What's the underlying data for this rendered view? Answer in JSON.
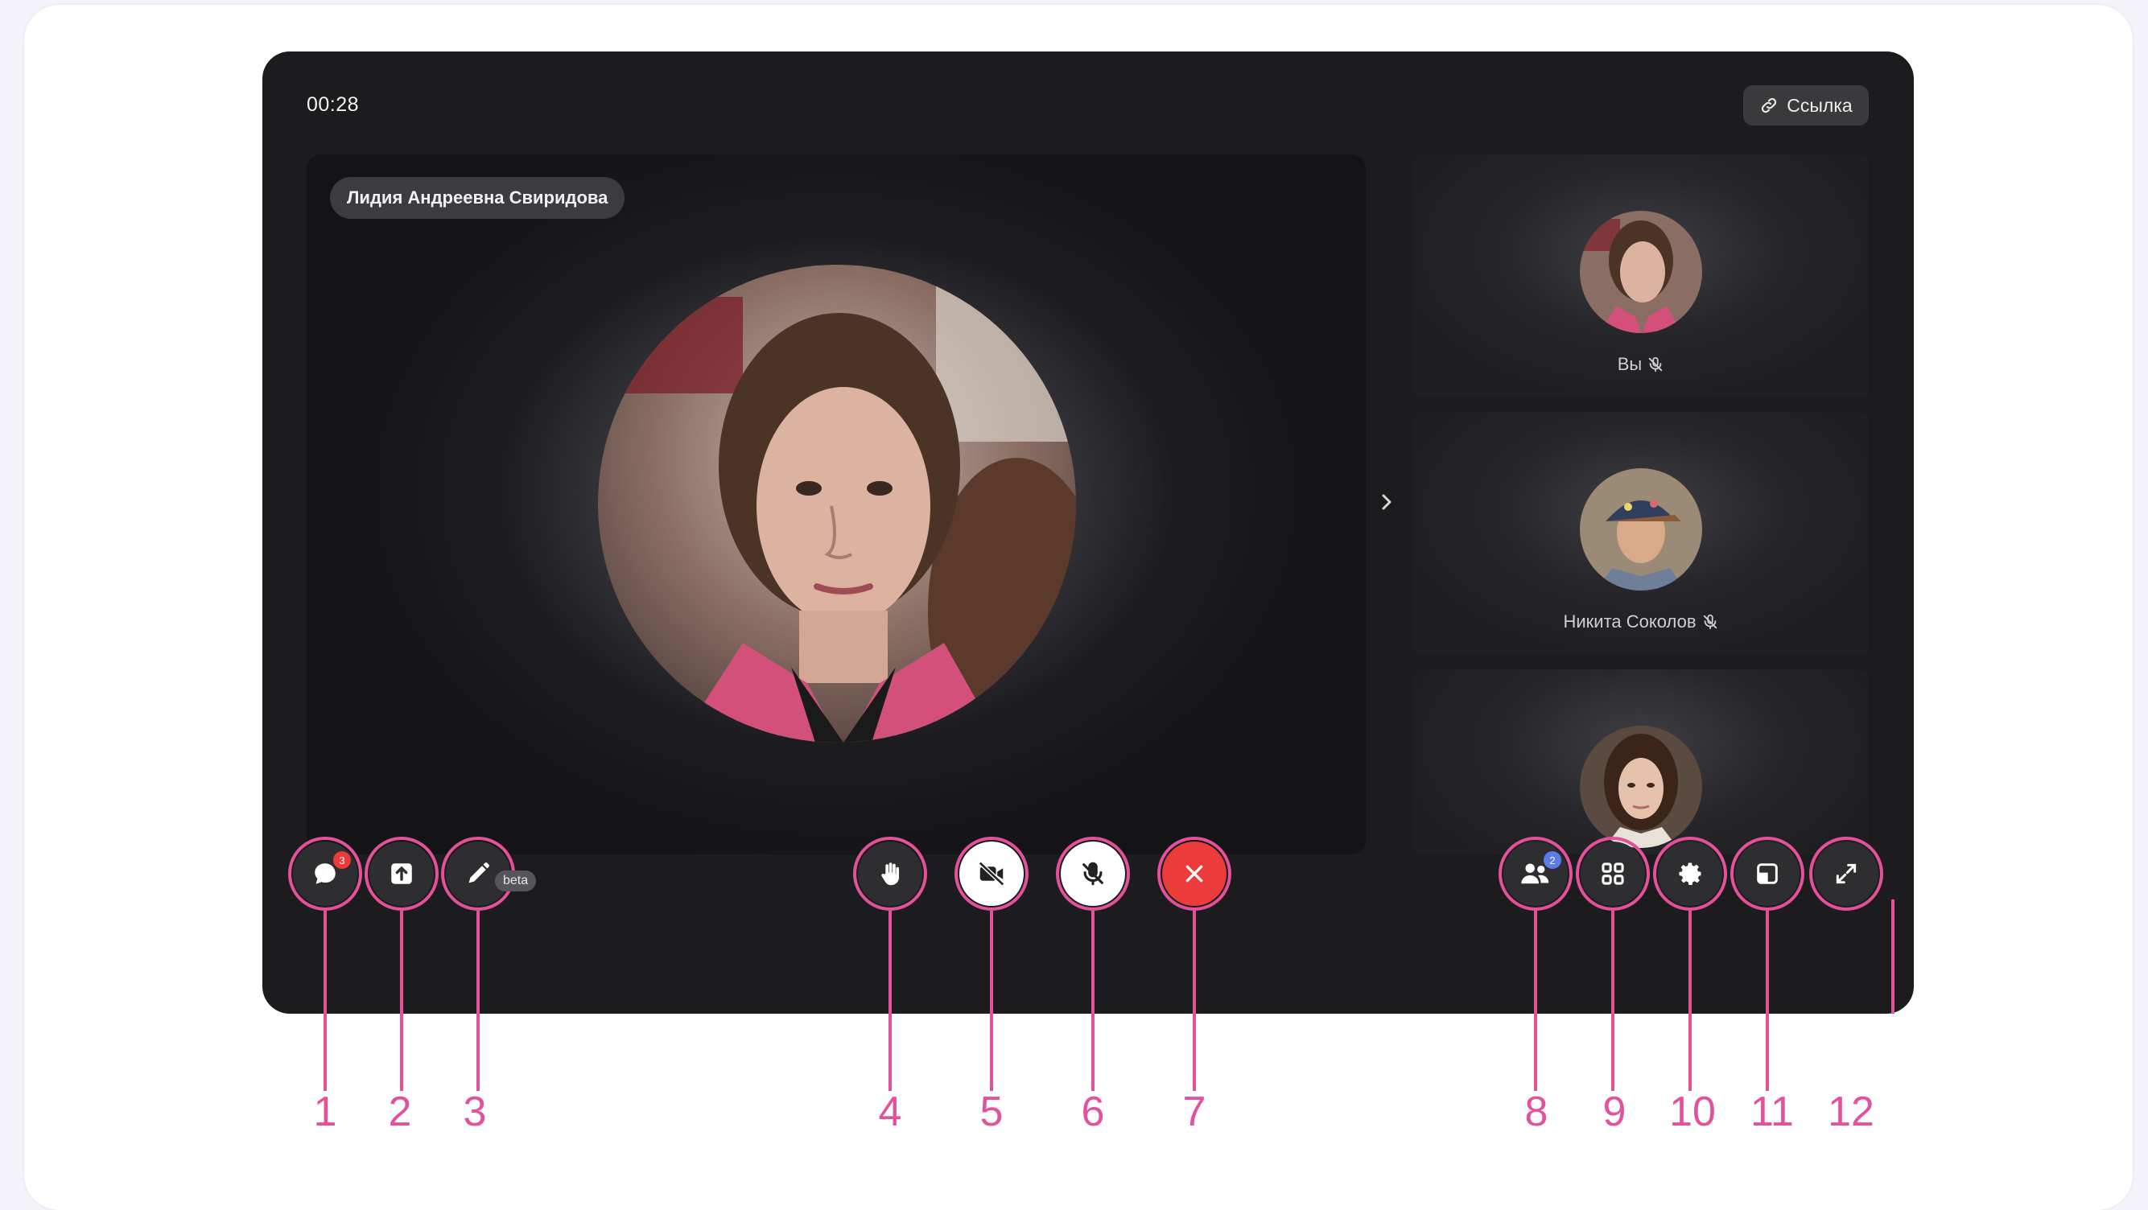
{
  "call": {
    "timer": "00:28",
    "link_label": "Ссылка",
    "main_speaker": "Лидия Андреевна Свиридова"
  },
  "participants": [
    {
      "name": "Вы",
      "muted": true
    },
    {
      "name": "Никита Соколов",
      "muted": true
    },
    {
      "name": "",
      "muted": false
    }
  ],
  "toolbar": {
    "chat_badge": "3",
    "participants_badge": "2",
    "draw_tag": "beta"
  },
  "callouts": [
    "1",
    "2",
    "3",
    "4",
    "5",
    "6",
    "7",
    "8",
    "9",
    "10",
    "11",
    "12"
  ],
  "colors": {
    "accent": "#e4519a",
    "end_call": "#ec3b3b",
    "window_bg": "#1c1c1e"
  },
  "icons": {
    "chat": "chat-icon",
    "share": "screen-share-icon",
    "draw": "pencil-icon",
    "hand": "raise-hand-icon",
    "camera": "camera-off-icon",
    "mic": "mic-off-icon",
    "end": "end-call-icon",
    "people": "participants-icon",
    "grid": "grid-layout-icon",
    "settings": "gear-icon",
    "pip": "picture-in-picture-icon",
    "fullscreen": "fullscreen-icon",
    "link": "link-icon"
  }
}
